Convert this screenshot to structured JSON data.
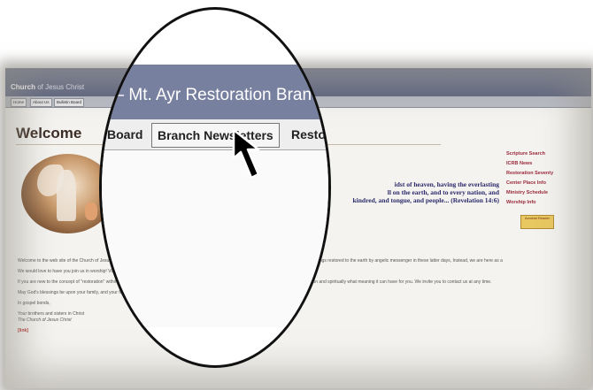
{
  "site": {
    "title_bold": "Church",
    "title_rest": " of Jesus Christ"
  },
  "nav": {
    "tabs": [
      "Home",
      "About Us",
      "Bulletin Board",
      "Branch Newsletters",
      "Restoration"
    ]
  },
  "zoom": {
    "title": "t – Mt. Ayr Restoration Branch",
    "tab_left": "Board",
    "tab_active": "Branch Newsletters",
    "tab_right": "Resto"
  },
  "main": {
    "heading": "Welcome",
    "quote": {
      "line1": "idst of heaven, having the everlasting",
      "line2": "ll on the earth, and to every nation, and",
      "line3": "kindred, and tongue, and people... (Revelation 14:6)"
    },
    "paragraphs": [
      "Welcome to the web site of the Church of Jesus Christ, (Mount Ayr Restoration Branch)! Our web site (angel message.org) is named in honor of the teachings restored to the earth by angelic messenger in these latter days, Instead, we are here as a memorial gospel rich in hope and in blessing.",
      "We would love to have you join us in worship! Visit the \"About Us\" page to find your way to our front door. Our worship schedule is there as well.",
      "If you are new to the concept of \"restoration\" within the Church of Jesus Christ, we would be happy to explain what meaning that has for our congregation and spiritually what meaning it can have for you. We invite you to contact us at any time.",
      "May God's blessings be upon your family, and your future be one that instills a legacy of righteousness.",
      "In gospel bonds,",
      "Your brothers and sisters in Christ",
      "The Church of Jesus Christ"
    ],
    "bottom_link": "[link]"
  },
  "sidebar": {
    "items": [
      "Scripture Search",
      "ICRB News",
      "Restoration Seventy",
      "Center Place Info",
      "Ministry Schedule",
      "Worship Info"
    ],
    "badge": "Acrobat Reader"
  }
}
